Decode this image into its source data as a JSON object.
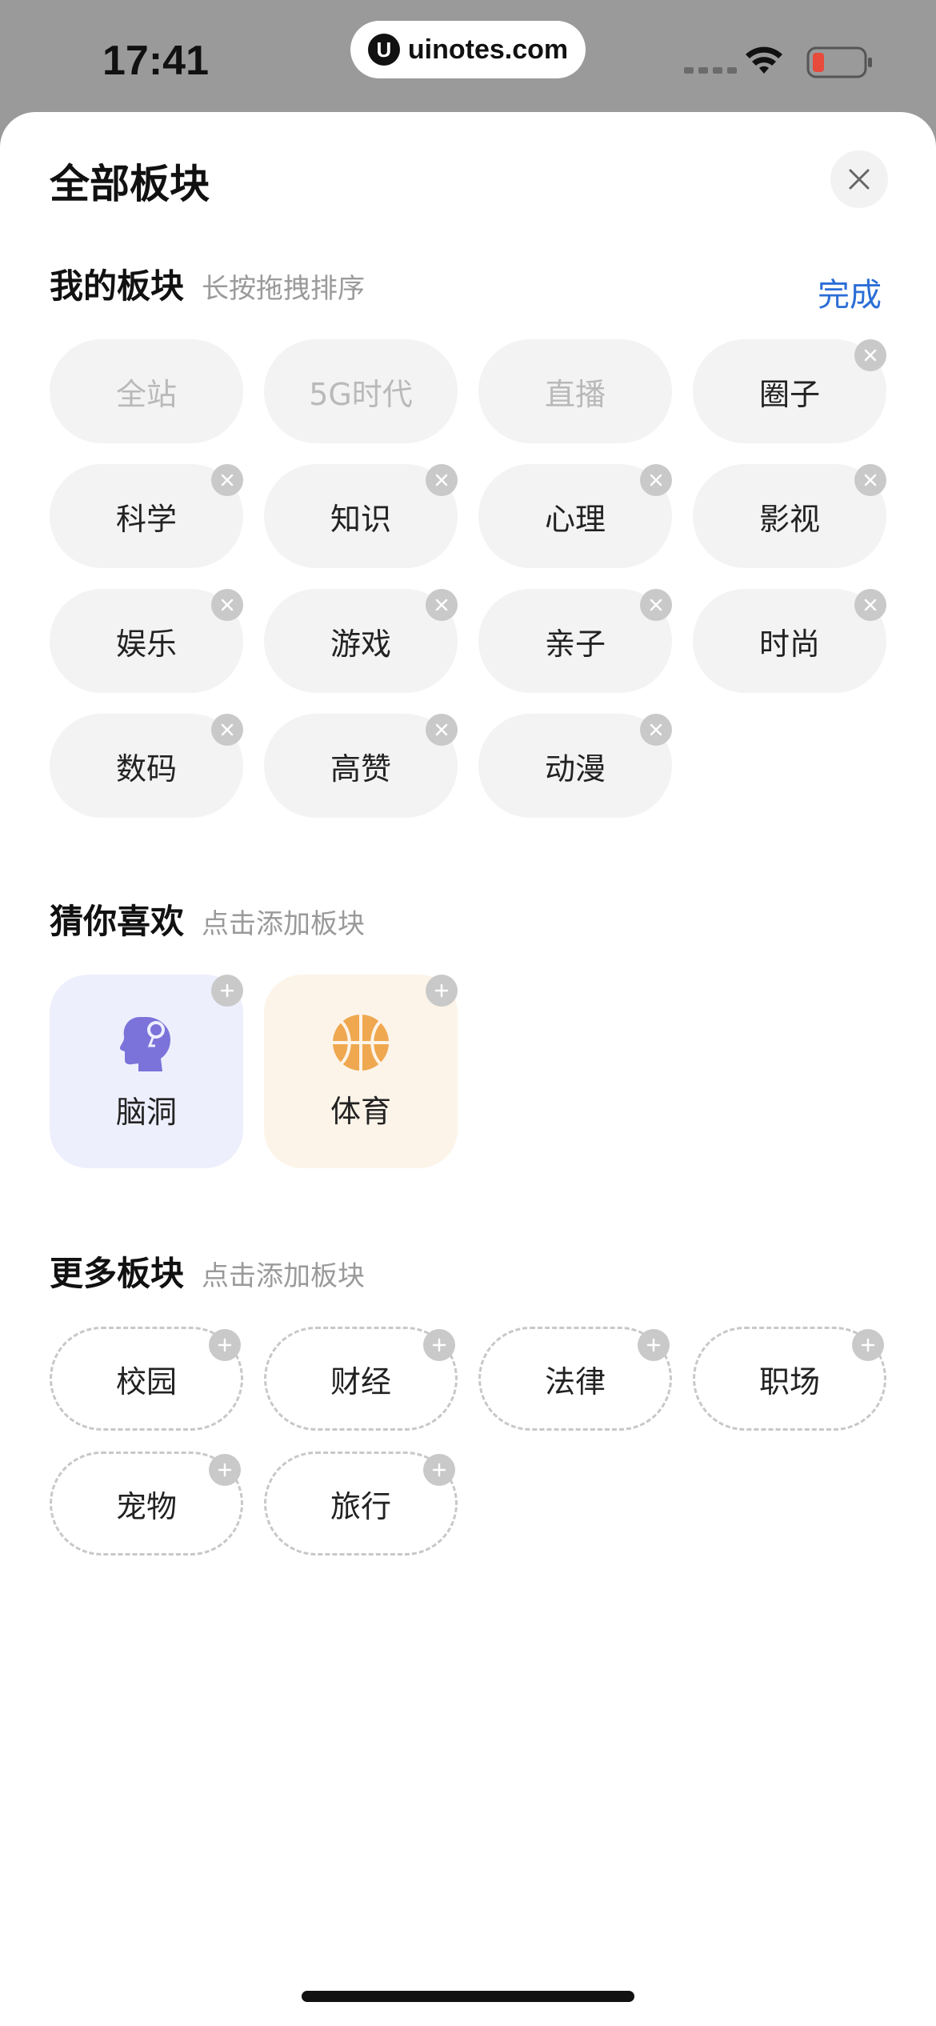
{
  "status_bar": {
    "time": "17:41",
    "url": "uinotes.com",
    "logo_letter": "U"
  },
  "sheet": {
    "title": "全部板块",
    "close_icon": "close-icon"
  },
  "my_section": {
    "title": "我的板块",
    "hint": "长按拖拽排序",
    "done_label": "完成",
    "fixed_items": [
      "全站",
      "5G时代",
      "直播"
    ],
    "items": [
      "圈子",
      "科学",
      "知识",
      "心理",
      "影视",
      "娱乐",
      "游戏",
      "亲子",
      "时尚",
      "数码",
      "高赞",
      "动漫"
    ]
  },
  "guess_section": {
    "title": "猜你喜欢",
    "hint": "点击添加板块",
    "cards": [
      {
        "label": "脑洞",
        "icon": "brain-head-icon",
        "color": "#7b73d9"
      },
      {
        "label": "体育",
        "icon": "basketball-icon",
        "color": "#efa84f"
      }
    ]
  },
  "more_section": {
    "title": "更多板块",
    "hint": "点击添加板块",
    "items": [
      "校园",
      "财经",
      "法律",
      "职场",
      "宠物",
      "旅行"
    ]
  },
  "colors": {
    "accent": "#2b6ed6",
    "chip_bg": "#f3f3f3",
    "badge": "#c9c9c9"
  }
}
